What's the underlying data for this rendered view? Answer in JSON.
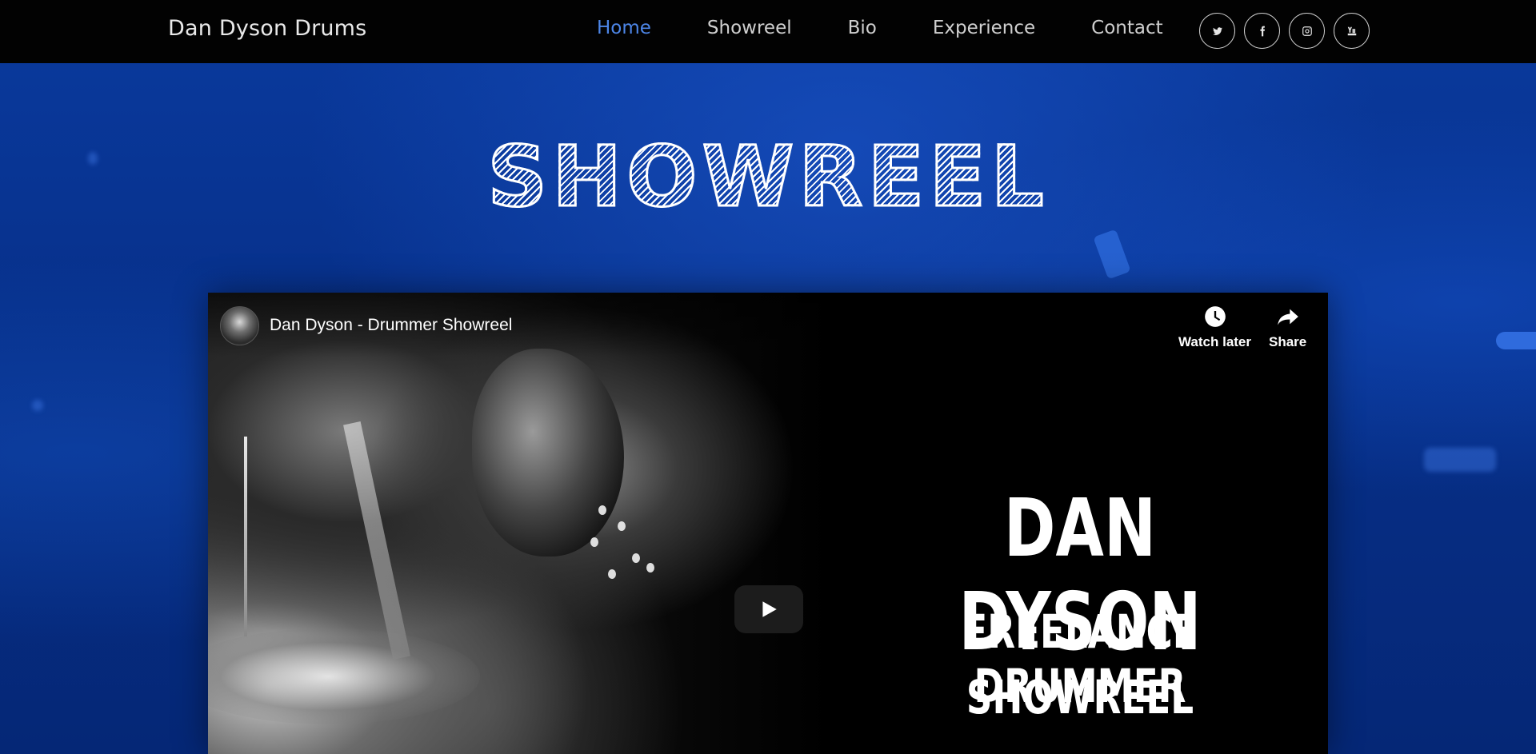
{
  "navbar": {
    "brand": "Dan Dyson Drums",
    "links": [
      "Home",
      "Showreel",
      "Bio",
      "Experience",
      "Contact"
    ],
    "active_link": "Home",
    "social_icons": [
      "twitter-icon",
      "facebook-icon",
      "instagram-icon",
      "youtube-icon"
    ],
    "social_glyphs": {
      "twitter": "t",
      "facebook": "f",
      "instagram": "◎",
      "youtube": "You"
    }
  },
  "section": {
    "heading": "SHOWREEL"
  },
  "video": {
    "title": "Dan Dyson - Drummer Showreel",
    "watch_later_label": "Watch later",
    "share_label": "Share",
    "poster_lines": [
      "DAN DYSON",
      "FREELANCE DRUMMER",
      "SHOWREEL"
    ]
  },
  "colors": {
    "background": "#07318c",
    "navbar": "#020202",
    "active_link": "#4d86e8",
    "nav_text": "#cfcfcf"
  }
}
